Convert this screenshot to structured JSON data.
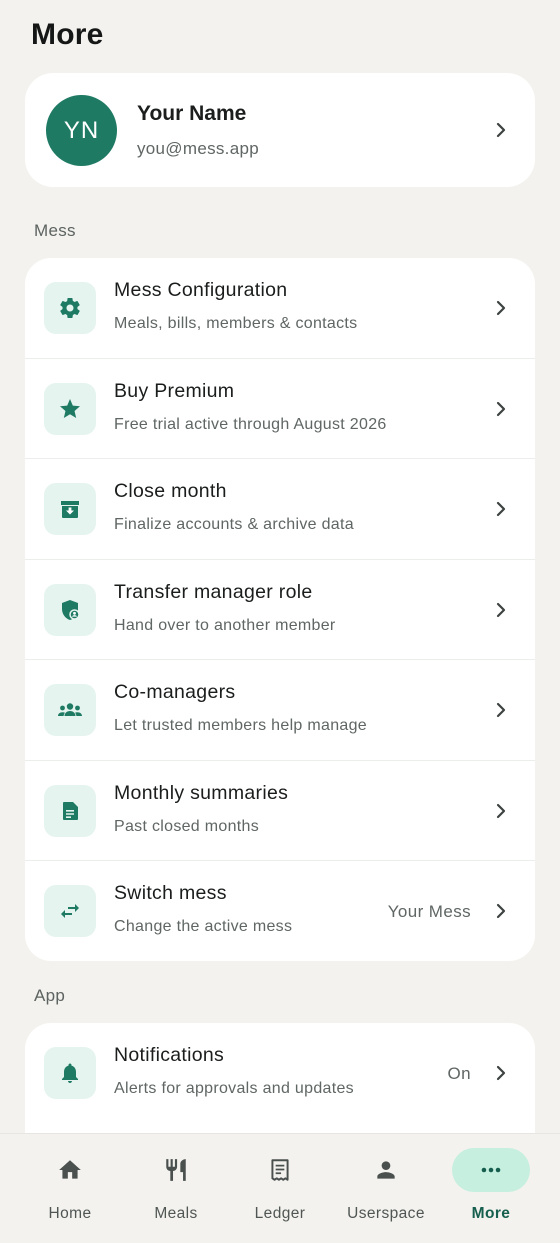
{
  "header": {
    "title": "More"
  },
  "profile": {
    "initials": "YN",
    "name": "Your Name",
    "email": "you@mess.app"
  },
  "sections": {
    "mess": {
      "label": "Mess",
      "items": [
        {
          "icon": "gear-icon",
          "title": "Mess Configuration",
          "subtitle": "Meals, bills, members & contacts"
        },
        {
          "icon": "star-icon",
          "title": "Buy Premium",
          "subtitle": "Free trial active through August 2026"
        },
        {
          "icon": "archive-icon",
          "title": "Close month",
          "subtitle": "Finalize accounts & archive data"
        },
        {
          "icon": "shield-person-icon",
          "title": "Transfer manager role",
          "subtitle": "Hand over to another member"
        },
        {
          "icon": "group-icon",
          "title": "Co-managers",
          "subtitle": "Let trusted members help manage"
        },
        {
          "icon": "summary-document-icon",
          "title": "Monthly summaries",
          "subtitle": "Past closed months"
        },
        {
          "icon": "swap-arrows-icon",
          "title": "Switch mess",
          "subtitle": "Change the active mess",
          "value": "Your Mess"
        }
      ]
    },
    "app": {
      "label": "App",
      "items": [
        {
          "icon": "bell-icon",
          "title": "Notifications",
          "subtitle": "Alerts for approvals and updates",
          "value": "On"
        }
      ]
    }
  },
  "bottom_nav": {
    "items": [
      {
        "icon": "home-icon",
        "label": "Home"
      },
      {
        "icon": "fork-knife-icon",
        "label": "Meals"
      },
      {
        "icon": "receipt-icon",
        "label": "Ledger"
      },
      {
        "icon": "person-icon",
        "label": "Userspace"
      },
      {
        "icon": "more-dots-icon",
        "label": "More"
      }
    ],
    "active": "More"
  },
  "colors": {
    "background": "#f3f2ee",
    "card": "#ffffff",
    "accent": "#1f7a64",
    "icon_tile": "#e5f4ee",
    "active_pill": "#c6efe0"
  }
}
